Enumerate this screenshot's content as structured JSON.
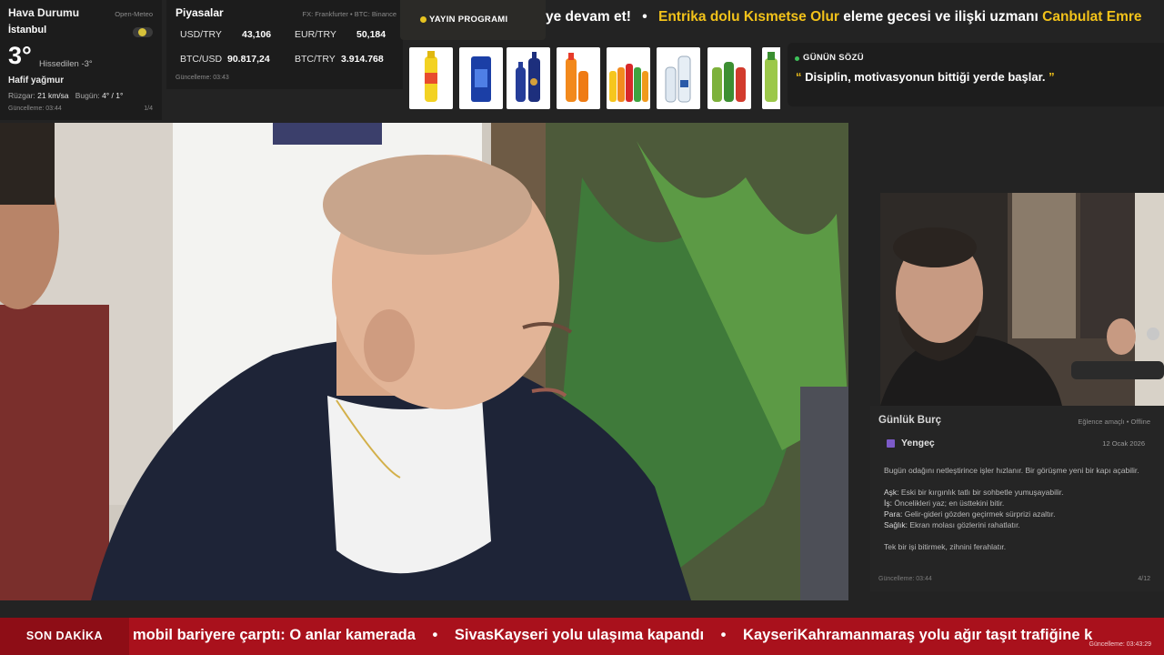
{
  "weather": {
    "title": "Hava Durumu",
    "source": "Open-Meteo",
    "city": "İstanbul",
    "temperature": "3°",
    "feels_like": "Hissedilen -3°",
    "description": "Hafif yağmur",
    "wind_label": "Rüzgar:",
    "wind_value": "21 km/sa",
    "today_label": "Bugün:",
    "today_value": "4° / 1°",
    "updated": "Güncelleme: 03:44",
    "page": "1/4"
  },
  "markets": {
    "title": "Piyasalar",
    "source": "FX: Frankfurter • BTC: Binance",
    "rows": [
      {
        "label": "USD/TRY",
        "value": "43,106"
      },
      {
        "label": "EUR/TRY",
        "value": "50,184"
      },
      {
        "label": "BTC/USD",
        "value": "90.817,24"
      },
      {
        "label": "BTC/TRY",
        "value": "3.914.768"
      }
    ],
    "updated": "Güncelleme: 03:43"
  },
  "schedule": {
    "label": "YAYIN PROGRAMI"
  },
  "top_ticker": {
    "lead": "ye devam et!",
    "sep": "•",
    "highlight1": "Entrika dolu Kısmetse Olur",
    "mid": "eleme gecesi ve ilişki uzmanı",
    "highlight2": "Canbulat Emre"
  },
  "quote": {
    "label": "GÜNÜN SÖZÜ",
    "open_mark": "“",
    "text": "Disiplin, motivasyonun bittiği yerde başlar.",
    "close_mark": "”"
  },
  "horoscope": {
    "title": "Günlük Burç",
    "meta": "Eğlence amaçlı • Offline",
    "sign": "Yengeç",
    "date": "12 Ocak 2026",
    "intro": "Bugün odağını netleştirince işler hızlanır. Bir görüşme yeni bir kapı açabilir.",
    "love_label": "Aşk:",
    "love": "Eski bir kırgınlık tatlı bir sohbetle yumuşayabilir.",
    "work_label": "İş:",
    "work": "Öncelikleri yaz; en üsttekini bitir.",
    "money_label": "Para:",
    "money": "Gelir-gideri gözden geçirmek sürprizi azaltır.",
    "health_label": "Sağlık:",
    "health": "Ekran molası gözlerini rahatlatır.",
    "tip": "Tek bir işi bitirmek, zihnini ferahlatır.",
    "updated": "Güncelleme: 03:44",
    "page": "4/12"
  },
  "breaking": {
    "label": "SON DAKİKA",
    "item1": "mobil bariyere çarptı: O anlar kamerada",
    "item2": "SivasKayseri yolu ulaşıma kapandı",
    "item3": "KayseriKahramanmaraş yolu ağır taşıt trafiğine k",
    "sep": "•",
    "updated": "Güncelleme: 03:43:29"
  },
  "colors": {
    "accent_yellow": "#f2c21a",
    "breaking_red": "#a9111c",
    "quote_dot_green": "#3ec25a"
  }
}
